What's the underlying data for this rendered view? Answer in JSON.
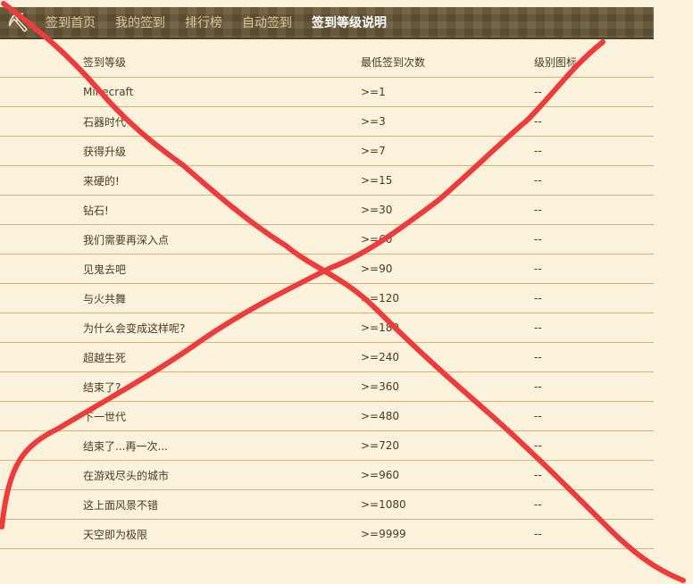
{
  "nav": {
    "logo_icon": "minecraft-logo-icon",
    "items": [
      {
        "label": "签到首页",
        "active": false
      },
      {
        "label": "我的签到",
        "active": false
      },
      {
        "label": "排行榜",
        "active": false
      },
      {
        "label": "自动签到",
        "active": false
      },
      {
        "label": "签到等级说明",
        "active": true
      }
    ]
  },
  "table": {
    "headers": [
      "签到等级",
      "最低签到次数",
      "级别图标"
    ],
    "rows": [
      {
        "name": "Minecraft",
        "min": ">=1",
        "icon": "--"
      },
      {
        "name": "石器时代",
        "min": ">=3",
        "icon": "--"
      },
      {
        "name": "获得升级",
        "min": ">=7",
        "icon": "--"
      },
      {
        "name": "来硬的!",
        "min": ">=15",
        "icon": "--"
      },
      {
        "name": "钻石!",
        "min": ">=30",
        "icon": "--"
      },
      {
        "name": "我们需要再深入点",
        "min": ">=60",
        "icon": "--"
      },
      {
        "name": "见鬼去吧",
        "min": ">=90",
        "icon": "--"
      },
      {
        "name": "与火共舞",
        "min": ">=120",
        "icon": "--"
      },
      {
        "name": "为什么会变成这样呢?",
        "min": ">=180",
        "icon": "--"
      },
      {
        "name": "超越生死",
        "min": ">=240",
        "icon": "--"
      },
      {
        "name": "结束了?",
        "min": ">=360",
        "icon": "--"
      },
      {
        "name": "下一世代",
        "min": ">=480",
        "icon": "--"
      },
      {
        "name": "结束了...再一次...",
        "min": ">=720",
        "icon": "--"
      },
      {
        "name": "在游戏尽头的城市",
        "min": ">=960",
        "icon": "--"
      },
      {
        "name": "这上面风景不错",
        "min": ">=1080",
        "icon": "--"
      },
      {
        "name": "天空即为极限",
        "min": ">=9999",
        "icon": "--"
      }
    ]
  },
  "overlay": {
    "mark": "red-cross-mark",
    "color": "#ee3b3b"
  }
}
